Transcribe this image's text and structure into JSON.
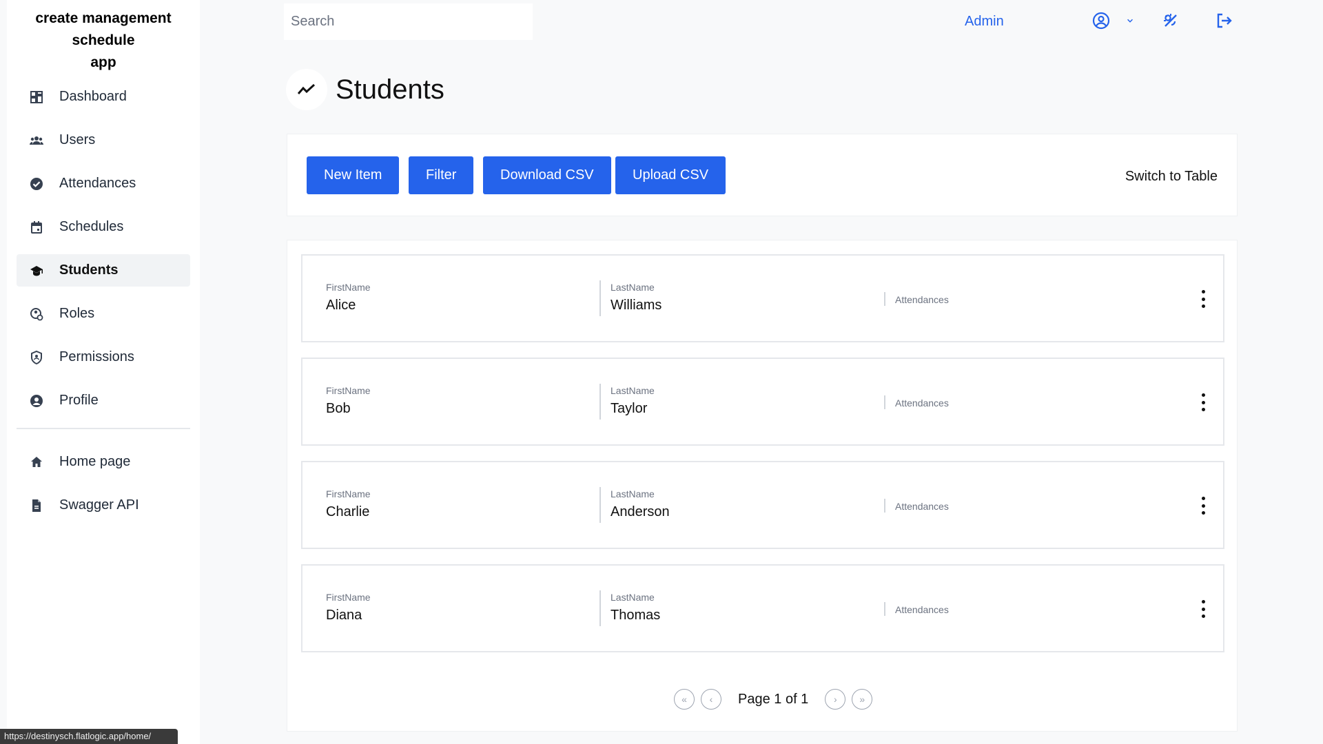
{
  "app": {
    "title_line1": "create management schedule",
    "title_line2": "app"
  },
  "sidebar": {
    "items": [
      {
        "label": "Dashboard",
        "icon": "dashboard-icon"
      },
      {
        "label": "Users",
        "icon": "users-icon"
      },
      {
        "label": "Attendances",
        "icon": "check-circle-icon"
      },
      {
        "label": "Schedules",
        "icon": "calendar-icon"
      },
      {
        "label": "Students",
        "icon": "graduation-cap-icon",
        "active": true
      },
      {
        "label": "Roles",
        "icon": "roles-icon"
      },
      {
        "label": "Permissions",
        "icon": "shield-icon"
      },
      {
        "label": "Profile",
        "icon": "profile-icon"
      }
    ],
    "footer_items": [
      {
        "label": "Home page",
        "icon": "home-icon"
      },
      {
        "label": "Swagger API",
        "icon": "document-icon"
      }
    ]
  },
  "status_bar": {
    "url": "https://destinysch.flatlogic.app/home/"
  },
  "topbar": {
    "search_placeholder": "Search",
    "user_label": "Admin",
    "icons": [
      "user-circle-icon",
      "chevron-down-icon",
      "theme-toggle-icon",
      "logout-icon"
    ],
    "accent_color": "#2563eb"
  },
  "page": {
    "title": "Students",
    "icon": "trend-icon"
  },
  "toolbar": {
    "new_item": "New Item",
    "filter": "Filter",
    "download_csv": "Download CSV",
    "upload_csv": "Upload CSV",
    "switch_view": "Switch to Table",
    "button_color": "#2563eb"
  },
  "list": {
    "labels": {
      "first": "FirstName",
      "last": "LastName",
      "attendances": "Attendances"
    },
    "rows": [
      {
        "first": "Alice",
        "last": "Williams"
      },
      {
        "first": "Bob",
        "last": "Taylor"
      },
      {
        "first": "Charlie",
        "last": "Anderson"
      },
      {
        "first": "Diana",
        "last": "Thomas"
      }
    ]
  },
  "pagination": {
    "text": "Page 1 of 1",
    "current": 1,
    "total": 1
  }
}
